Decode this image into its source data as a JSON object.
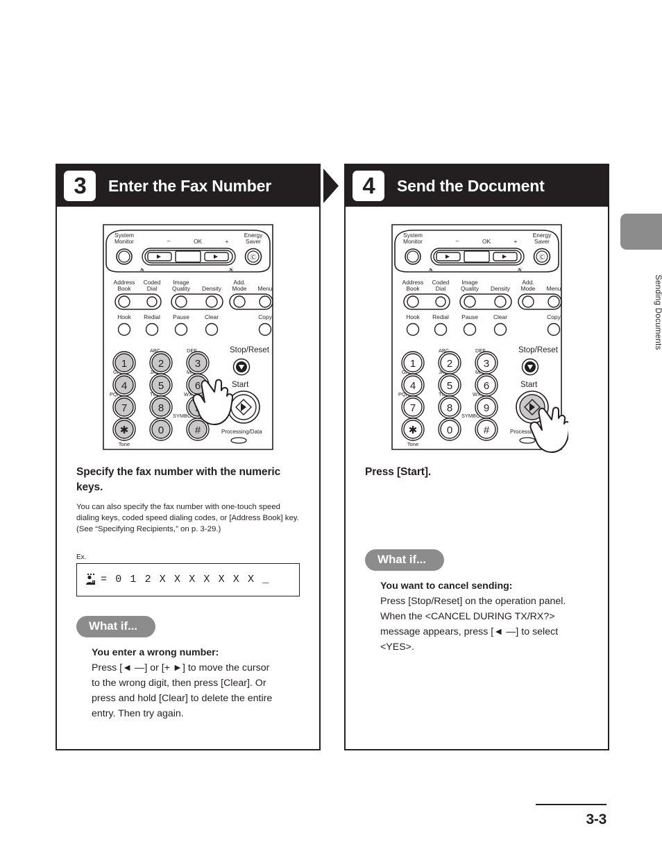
{
  "document": {
    "page_number": "3-3",
    "side_tab_label": "Sending Documents"
  },
  "steps": [
    {
      "number": "3",
      "title": "Enter the Fax Number",
      "lead": "Specify the fax number with the numeric keys.",
      "note": "You can also specify the fax number with one-touch speed dialing keys, coded speed dialing codes, or [Address Book] key. (See “Specifying Recipients,” on p. 3-29.)",
      "example_label": "Ex.",
      "lcd_text": "= 0 1 2 X X X X X X X _",
      "whatif": {
        "pill": "What if...",
        "heading": "You enter a wrong number:",
        "lines": [
          "Press [◄ —] or [+ ►] to move the cursor",
          "to the wrong digit, then press [Clear]. Or",
          "press and hold [Clear] to delete the entire",
          "entry. Then try again."
        ]
      }
    },
    {
      "number": "4",
      "title": "Send the Document",
      "lead": "Press [Start].",
      "whatif": {
        "pill": "What if...",
        "heading": "You want to cancel sending:",
        "lines": [
          "Press [Stop/Reset] on the operation panel.",
          "When the <CANCEL DURING TX/RX?>",
          "message appears, press [◄ —] to select",
          "<YES>."
        ]
      }
    }
  ],
  "control_panel": {
    "top_row": {
      "system_monitor": "System\nMonitor",
      "minus": "–",
      "ok": "OK",
      "plus": "+",
      "energy_saver": "Energy\nSaver"
    },
    "function_row_1": [
      "Address\nBook",
      "Coded\nDial",
      "Image\nQuality",
      "Density",
      "Add.\nMode",
      "Menu"
    ],
    "function_row_2": [
      "Hook",
      "Redial",
      "Pause",
      "Clear",
      "Copy"
    ],
    "keypad": [
      {
        "digit": "1",
        "letters": ""
      },
      {
        "digit": "2",
        "letters": "ABC"
      },
      {
        "digit": "3",
        "letters": "DEF"
      },
      {
        "digit": "4",
        "letters": "GHI"
      },
      {
        "digit": "5",
        "letters": "JKL"
      },
      {
        "digit": "6",
        "letters": "MNO"
      },
      {
        "digit": "7",
        "letters": "PQRS"
      },
      {
        "digit": "8",
        "letters": "TUV"
      },
      {
        "digit": "9",
        "letters": "WXYZ"
      },
      {
        "digit": "✱",
        "letters": "",
        "sublabel": "Tone"
      },
      {
        "digit": "0",
        "letters": ""
      },
      {
        "digit": "#",
        "letters": "SYMBOLS"
      }
    ],
    "stop_reset": "Stop/Reset",
    "start": "Start",
    "processing_data": "Processing/Data"
  },
  "colors": {
    "ink": "#231f20",
    "gray_pill": "#8c8c8c",
    "key_highlight": "#c9c9c9"
  }
}
